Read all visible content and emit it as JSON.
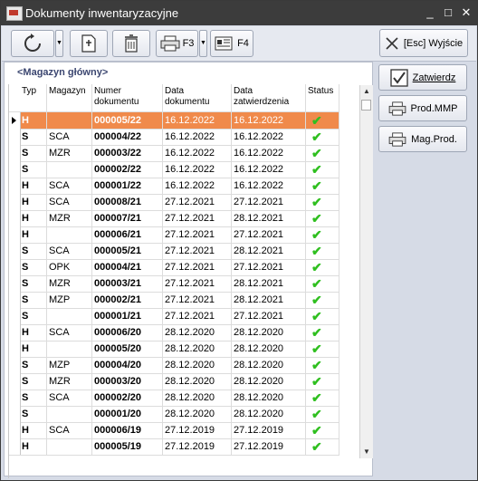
{
  "window": {
    "title": "Dokumenty inwentaryzacyjne",
    "minimize": "_",
    "maximize": "□",
    "close": "✕"
  },
  "toolbar": {
    "print_f3_label": "F3",
    "doc_f4_label": "F4",
    "exit_label": "[Esc] Wyjście"
  },
  "header": {
    "magazyn": "<Magazyn główny>"
  },
  "actions": {
    "zatwierdz": "Zatwierdz",
    "prod_mmp": "Prod.MMP",
    "mag_prod": "Mag.Prod."
  },
  "grid": {
    "columns": [
      "Typ",
      "Magazyn",
      "Numer\ndokumentu",
      "Data\ndokumentu",
      "Data\nzatwierdzenia",
      "Status"
    ],
    "rows": [
      {
        "typ": "H",
        "magazyn": "",
        "numer": "000005/22",
        "data_dok": "16.12.2022",
        "data_zatw": "16.12.2022",
        "status": "✔",
        "selected": true
      },
      {
        "typ": "S",
        "magazyn": "SCA",
        "numer": "000004/22",
        "data_dok": "16.12.2022",
        "data_zatw": "16.12.2022",
        "status": "✔"
      },
      {
        "typ": "S",
        "magazyn": "MZR",
        "numer": "000003/22",
        "data_dok": "16.12.2022",
        "data_zatw": "16.12.2022",
        "status": "✔"
      },
      {
        "typ": "S",
        "magazyn": "",
        "numer": "000002/22",
        "data_dok": "16.12.2022",
        "data_zatw": "16.12.2022",
        "status": "✔"
      },
      {
        "typ": "H",
        "magazyn": "SCA",
        "numer": "000001/22",
        "data_dok": "16.12.2022",
        "data_zatw": "16.12.2022",
        "status": "✔"
      },
      {
        "typ": "H",
        "magazyn": "SCA",
        "numer": "000008/21",
        "data_dok": "27.12.2021",
        "data_zatw": "27.12.2021",
        "status": "✔"
      },
      {
        "typ": "H",
        "magazyn": "MZR",
        "numer": "000007/21",
        "data_dok": "27.12.2021",
        "data_zatw": "28.12.2021",
        "status": "✔"
      },
      {
        "typ": "H",
        "magazyn": "",
        "numer": "000006/21",
        "data_dok": "27.12.2021",
        "data_zatw": "27.12.2021",
        "status": "✔"
      },
      {
        "typ": "S",
        "magazyn": "SCA",
        "numer": "000005/21",
        "data_dok": "27.12.2021",
        "data_zatw": "28.12.2021",
        "status": "✔"
      },
      {
        "typ": "S",
        "magazyn": "OPK",
        "numer": "000004/21",
        "data_dok": "27.12.2021",
        "data_zatw": "27.12.2021",
        "status": "✔"
      },
      {
        "typ": "S",
        "magazyn": "MZR",
        "numer": "000003/21",
        "data_dok": "27.12.2021",
        "data_zatw": "28.12.2021",
        "status": "✔"
      },
      {
        "typ": "S",
        "magazyn": "MZP",
        "numer": "000002/21",
        "data_dok": "27.12.2021",
        "data_zatw": "28.12.2021",
        "status": "✔"
      },
      {
        "typ": "S",
        "magazyn": "",
        "numer": "000001/21",
        "data_dok": "27.12.2021",
        "data_zatw": "27.12.2021",
        "status": "✔"
      },
      {
        "typ": "H",
        "magazyn": "SCA",
        "numer": "000006/20",
        "data_dok": "28.12.2020",
        "data_zatw": "28.12.2020",
        "status": "✔"
      },
      {
        "typ": "H",
        "magazyn": "",
        "numer": "000005/20",
        "data_dok": "28.12.2020",
        "data_zatw": "28.12.2020",
        "status": "✔"
      },
      {
        "typ": "S",
        "magazyn": "MZP",
        "numer": "000004/20",
        "data_dok": "28.12.2020",
        "data_zatw": "28.12.2020",
        "status": "✔"
      },
      {
        "typ": "S",
        "magazyn": "MZR",
        "numer": "000003/20",
        "data_dok": "28.12.2020",
        "data_zatw": "28.12.2020",
        "status": "✔"
      },
      {
        "typ": "S",
        "magazyn": "SCA",
        "numer": "000002/20",
        "data_dok": "28.12.2020",
        "data_zatw": "28.12.2020",
        "status": "✔"
      },
      {
        "typ": "S",
        "magazyn": "",
        "numer": "000001/20",
        "data_dok": "28.12.2020",
        "data_zatw": "28.12.2020",
        "status": "✔"
      },
      {
        "typ": "H",
        "magazyn": "SCA",
        "numer": "000006/19",
        "data_dok": "27.12.2019",
        "data_zatw": "27.12.2019",
        "status": "✔"
      },
      {
        "typ": "H",
        "magazyn": "",
        "numer": "000005/19",
        "data_dok": "27.12.2019",
        "data_zatw": "27.12.2019",
        "status": "✔"
      }
    ]
  },
  "colors": {
    "selected_row": "#f08a4b",
    "status_check": "#2fbf1f",
    "titlebar": "#3c3c3c",
    "panel_bg": "#d6dbe6"
  }
}
